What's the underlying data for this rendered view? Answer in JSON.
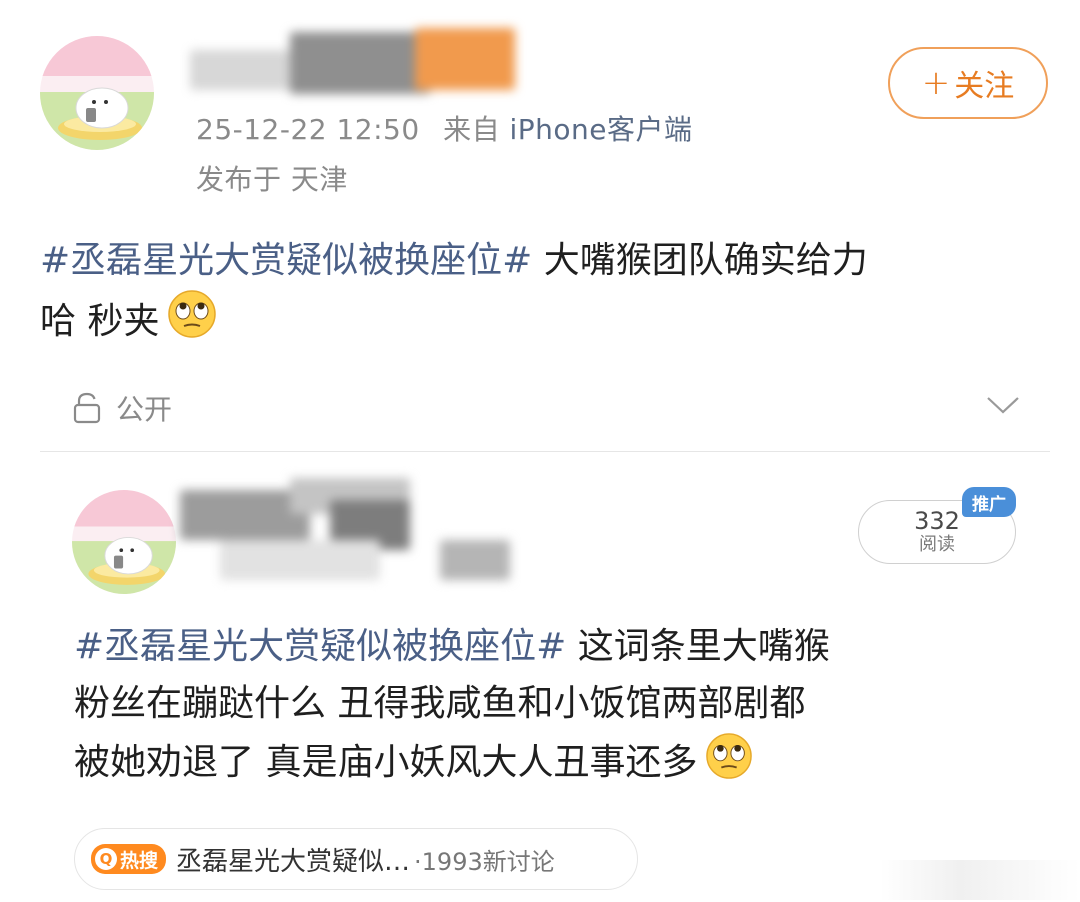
{
  "post1": {
    "follow_plus": "+",
    "follow_label": "关注",
    "timestamp": "25-12-22 12:50",
    "from_prefix": "来自",
    "source": "iPhone客户端",
    "location": "发布于 天津",
    "hashtag": "#丞磊星光大赏疑似被换座位#",
    "body_line1": " 大嘴猴团队确实给力",
    "body_line2": "哈  秒夹"
  },
  "privacy": {
    "label": "公开"
  },
  "post2": {
    "reads_count": "332",
    "reads_label": "阅读",
    "promo_badge": "推广",
    "hashtag": "#丞磊星光大赏疑似被换座位#",
    "body_line1": " 这词条里大嘴猴",
    "body_line2": "粉丝在蹦跶什么  丑得我咸鱼和小饭馆两部剧都",
    "body_line3": "被她劝退了  真是庙小妖风大人丑事还多"
  },
  "topic": {
    "badge_icon": "Q",
    "badge": "热搜",
    "title": "丞磊星光大赏疑似…",
    "count": "·1993新讨论"
  },
  "icons": [
    "avatar-seal",
    "lock-icon",
    "chevron-down-icon",
    "eye-roll-emoji",
    "hot-search-icon"
  ],
  "colors": {
    "accent": "#e77c22",
    "hashtag": "#4a5f86",
    "muted": "#8a8a8a",
    "promo": "#4a8fd9",
    "hot": "#ff8a1f"
  }
}
